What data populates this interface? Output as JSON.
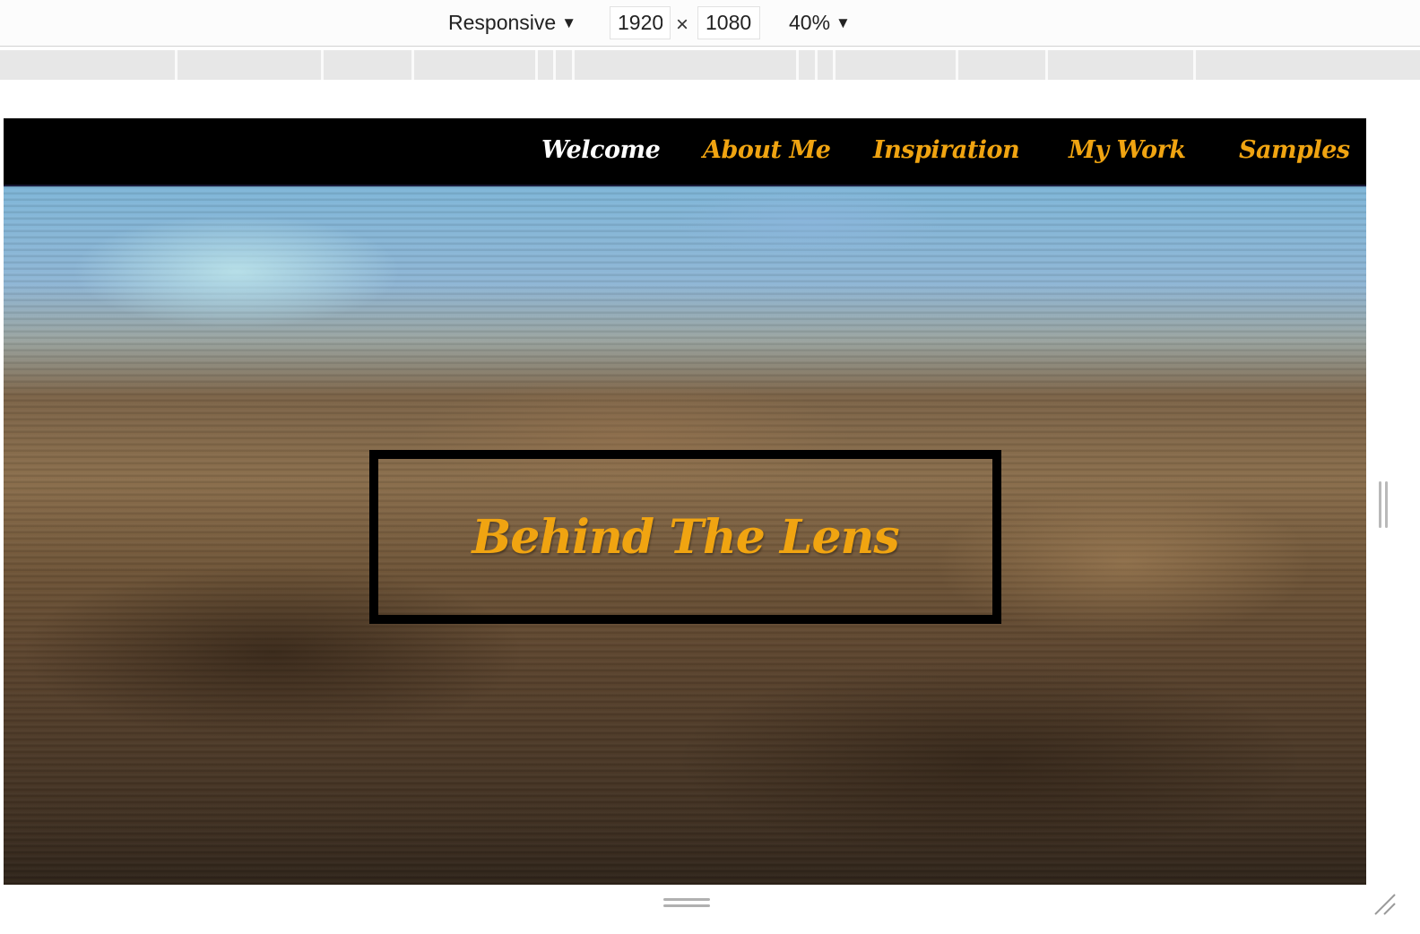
{
  "toolbar": {
    "device_label": "Responsive",
    "width_value": "1920",
    "height_value": "1080",
    "times_symbol": "×",
    "zoom_label": "40%",
    "caret": "▼"
  },
  "site": {
    "nav": {
      "items": [
        {
          "label": "Welcome",
          "active": true
        },
        {
          "label": "About Me",
          "active": false
        },
        {
          "label": "Inspiration",
          "active": false
        },
        {
          "label": "My Work",
          "active": false
        },
        {
          "label": "Samples",
          "active": false
        }
      ]
    },
    "hero": {
      "title": "Behind The Lens"
    }
  },
  "colors": {
    "accent": "#f0a411",
    "nav_bg": "#000000",
    "active_nav": "#ffffff"
  }
}
